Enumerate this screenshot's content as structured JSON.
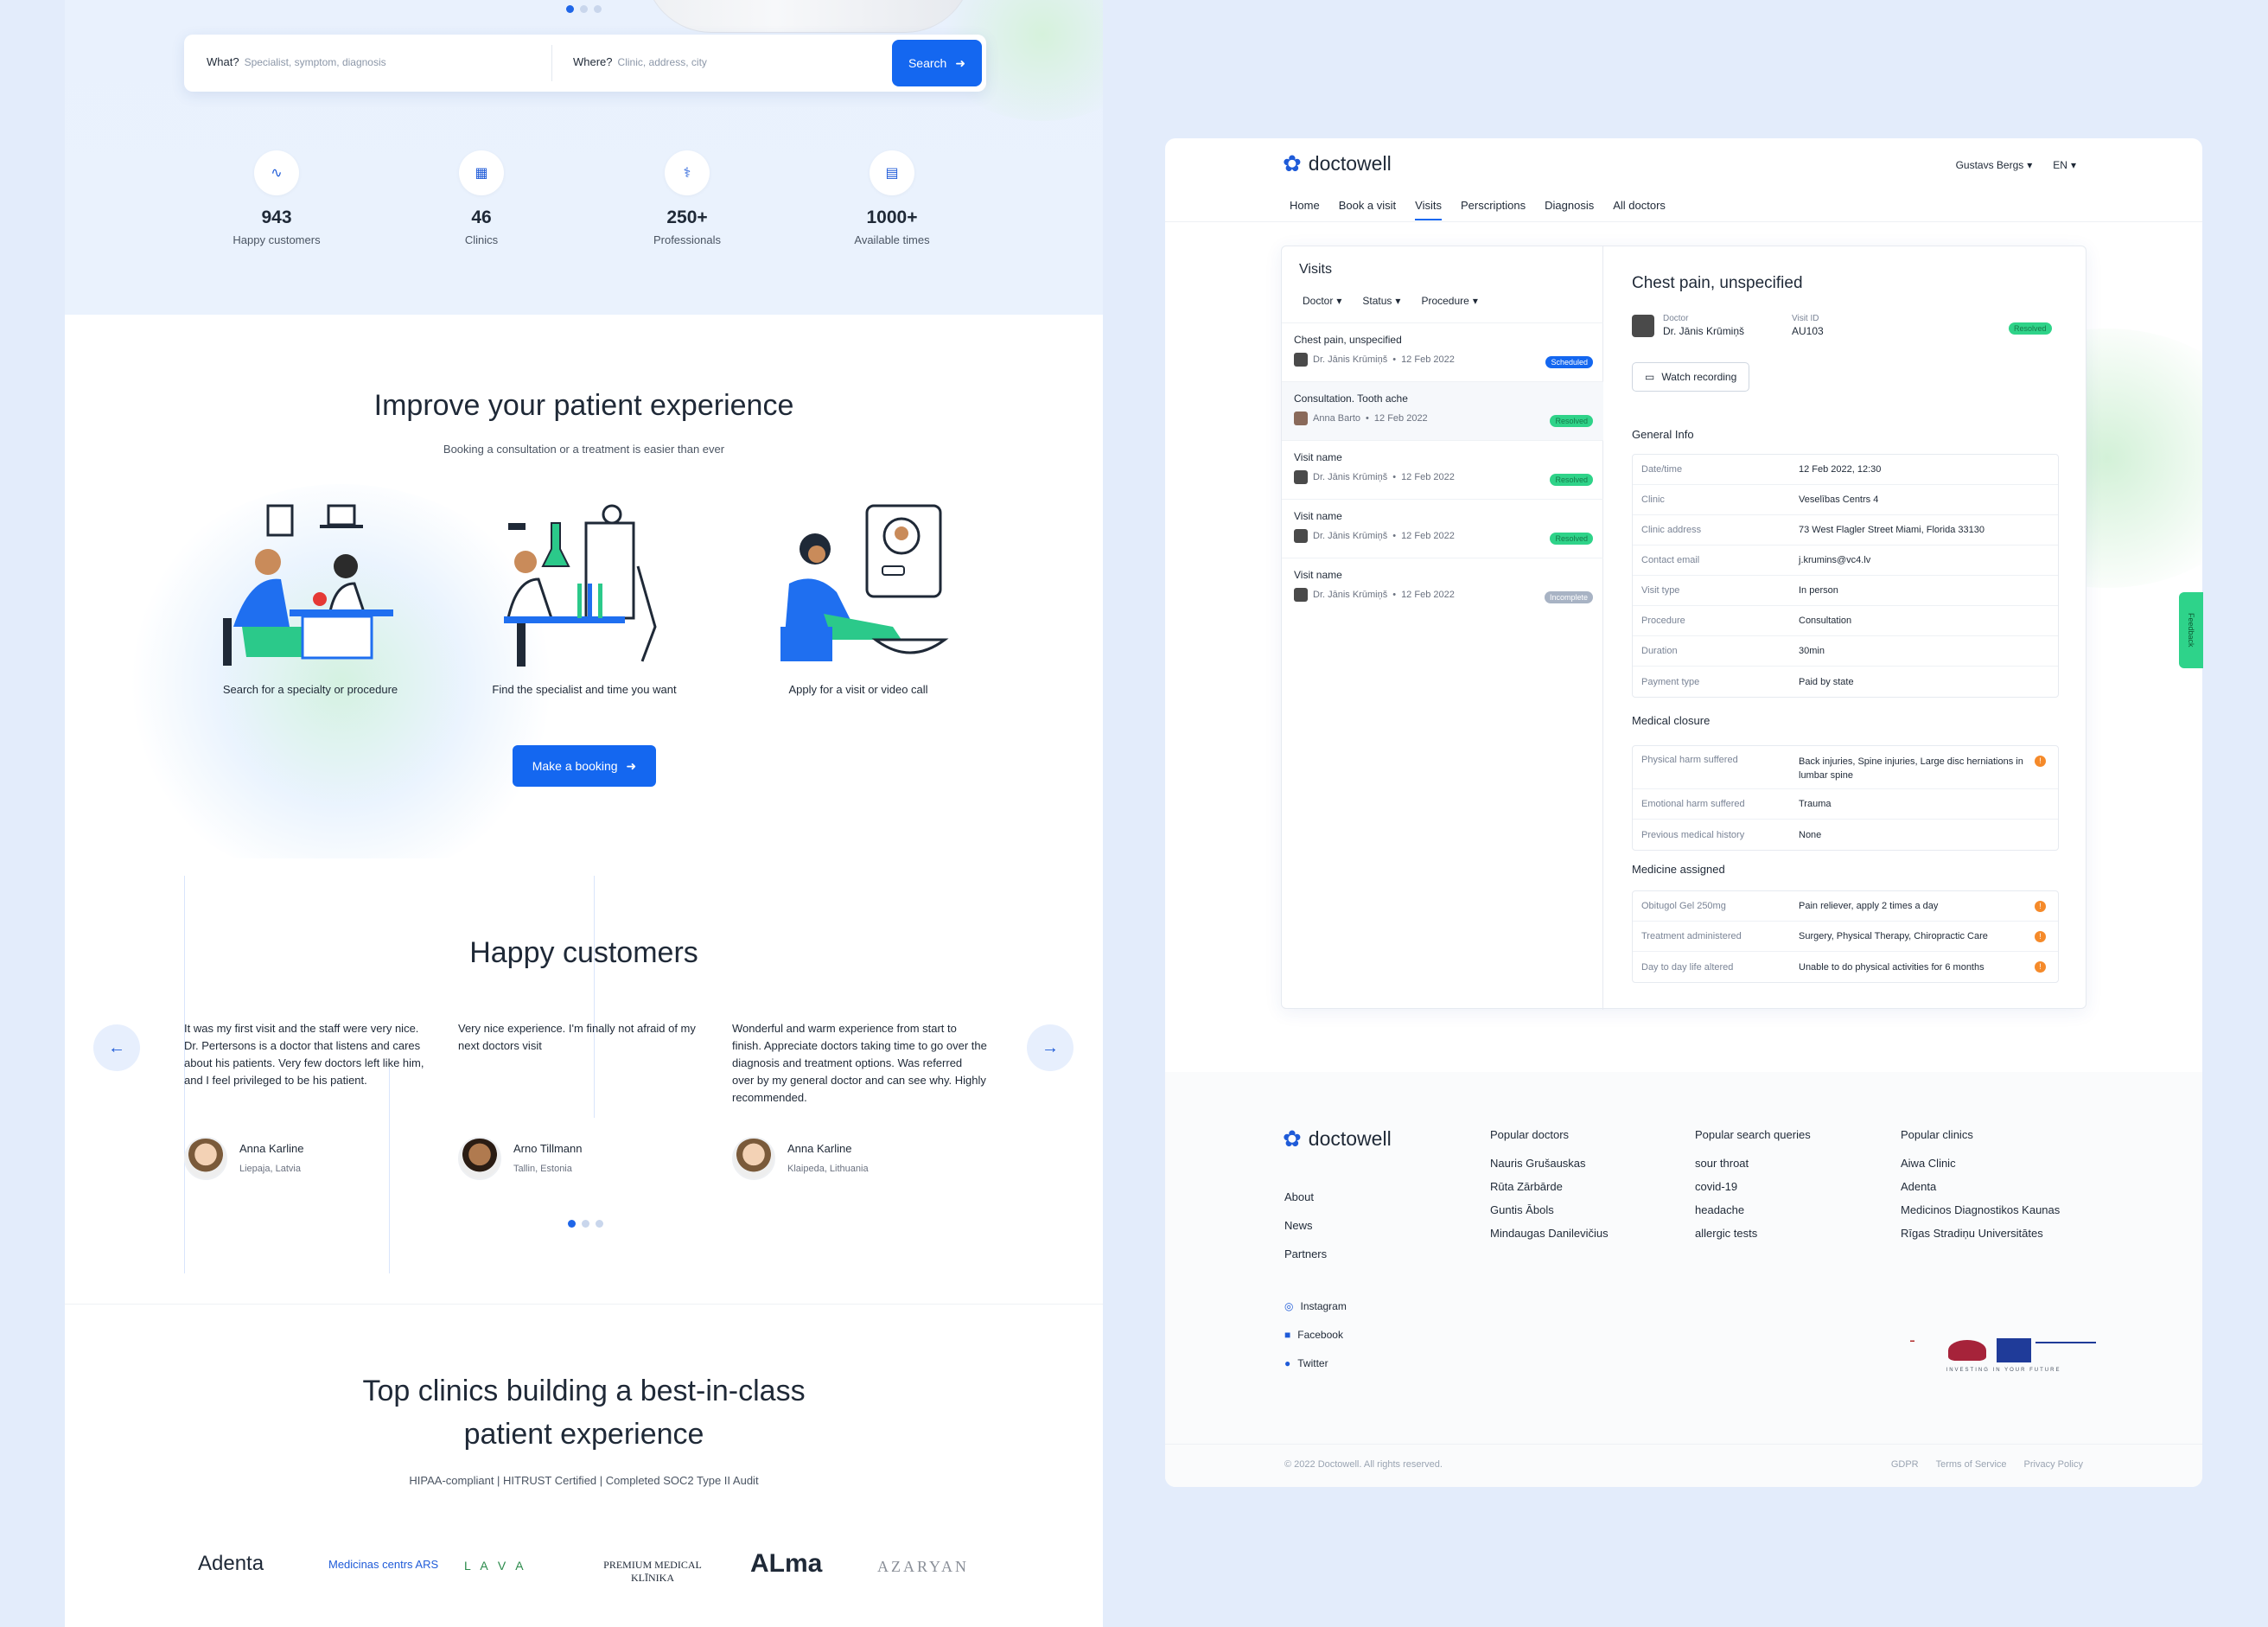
{
  "search": {
    "what_label": "What?",
    "what_placeholder": "Specialist, symptom, diagnosis",
    "where_label": "Where?",
    "where_placeholder": "Clinic, address, city",
    "button": "Search"
  },
  "stats": [
    {
      "value": "943",
      "label": "Happy customers",
      "icon": "pulse-icon"
    },
    {
      "value": "46",
      "label": "Clinics",
      "icon": "hospital-icon"
    },
    {
      "value": "250+",
      "label": "Professionals",
      "icon": "stethoscope-icon"
    },
    {
      "value": "1000+",
      "label": "Available times",
      "icon": "calendar-icon"
    }
  ],
  "improve": {
    "title": "Improve your patient experience",
    "subtitle": "Booking a consultation or a treatment is easier than ever",
    "steps": [
      "Search for a specialty or procedure",
      "Find the specialist and time you want",
      "Apply for a visit or video call"
    ],
    "button": "Make a booking"
  },
  "reviews": {
    "title": "Happy customers",
    "items": [
      {
        "text": "It was my first visit and the staff were very nice. Dr. Pertersons is a doctor that listens and cares about his patients. Very few doctors left like him, and I feel privileged to be his patient.",
        "name": "Anna Karline",
        "location": "Liepaja, Latvia"
      },
      {
        "text": "Very nice experience. I'm finally not afraid of my next doctors visit",
        "name": "Arno Tillmann",
        "location": "Tallin, Estonia"
      },
      {
        "text": "Wonderful and warm experience from start to finish. Appreciate doctors taking time to go over the diagnosis and treatment options. Was referred over by my general doctor and can see why. Highly recommended.",
        "name": "Anna Karline",
        "location": "Klaipeda, Lithuania"
      }
    ]
  },
  "clinics": {
    "title_line1": "Top clinics building a best-in-class",
    "title_line2": "patient experience",
    "subtitle": "HIPAA-compliant | HITRUST Certified | Completed SOC2 Type II Audit",
    "logos": [
      "Adenta",
      "Medicinas centrs ARS",
      "L A V A",
      "PREMIUM MEDICAL KLĪNIKA",
      "ALma",
      "AZARYAN"
    ]
  },
  "app": {
    "brand": "doctowell",
    "user": "Gustavs Bergs",
    "lang": "EN",
    "nav": [
      "Home",
      "Book a visit",
      "Visits",
      "Perscriptions",
      "Diagnosis",
      "All doctors"
    ],
    "active_nav": "Visits",
    "visits_title": "Visits",
    "filters": [
      "Doctor",
      "Status",
      "Procedure"
    ],
    "visits": [
      {
        "name": "Chest pain, unspecified",
        "doctor": "Dr. Jānis Krūmiņš",
        "date": "12 Feb 2022",
        "status": "Scheduled"
      },
      {
        "name": "Consultation. Tooth ache",
        "doctor": "Anna Barto",
        "date": "12 Feb 2022",
        "status": "Resolved"
      },
      {
        "name": "Visit name",
        "doctor": "Dr. Jānis Krūmiņš",
        "date": "12 Feb 2022",
        "status": "Resolved"
      },
      {
        "name": "Visit name",
        "doctor": "Dr. Jānis Krūmiņš",
        "date": "12 Feb 2022",
        "status": "Resolved"
      },
      {
        "name": "Visit name",
        "doctor": "Dr. Jānis Krūmiņš",
        "date": "12 Feb 2022",
        "status": "Incomplete"
      }
    ],
    "detail": {
      "title": "Chest pain, unspecified",
      "doctor_label": "Doctor",
      "doctor": "Dr. Jānis Krūmiņš",
      "visit_id_label": "Visit ID",
      "visit_id": "AU103",
      "status": "Resolved",
      "watch": "Watch recording",
      "general_title": "General Info",
      "general": [
        {
          "k": "Date/time",
          "v": "12 Feb 2022, 12:30"
        },
        {
          "k": "Clinic",
          "v": "Veselības Centrs 4"
        },
        {
          "k": "Clinic address",
          "v": "73 West Flagler Street Miami, Florida 33130"
        },
        {
          "k": "Contact email",
          "v": "j.krumins@vc4.lv"
        },
        {
          "k": "Visit type",
          "v": "In person"
        },
        {
          "k": "Procedure",
          "v": "Consultation"
        },
        {
          "k": "Duration",
          "v": "30min"
        },
        {
          "k": "Payment type",
          "v": "Paid by state"
        }
      ],
      "closure_title": "Medical closure",
      "closure": [
        {
          "k": "Physical harm suffered",
          "v": "Back injuries, Spine injuries, Large disc herniations in lumbar spine"
        },
        {
          "k": "Emotional harm suffered",
          "v": "Trauma"
        },
        {
          "k": "Previous medical history",
          "v": "None"
        }
      ],
      "medicine_title": "Medicine assigned",
      "medicine": [
        {
          "k": "Obitugol Gel 250mg",
          "v": "Pain reliever, apply 2 times a day"
        },
        {
          "k": "Treatment administered",
          "v": "Surgery, Physical Therapy, Chiropractic Care"
        },
        {
          "k": "Day to day life altered",
          "v": "Unable to do physical activities for 6 months"
        }
      ]
    },
    "footer": {
      "links": [
        "About",
        "News",
        "Partners"
      ],
      "social": [
        "Instagram",
        "Facebook",
        "Twitter"
      ],
      "col1_title": "Popular doctors",
      "col1": [
        "Nauris Grušauskas",
        "Rūta Zārbārde",
        "Guntis Ābols",
        "Mindaugas Danilevičius"
      ],
      "col2_title": "Popular search queries",
      "col2": [
        "sour throat",
        "covid-19",
        "headache",
        "allergic tests"
      ],
      "col3_title": "Popular clinics",
      "col3": [
        "Aiwa Clinic",
        "Adenta",
        "Medicinos Diagnostikos Kaunas",
        "Rīgas Stradiņu Universitātes"
      ],
      "copyright": "© 2022 Doctowell. All rights reserved.",
      "legal": [
        "GDPR",
        "Terms of Service",
        "Privacy Policy"
      ],
      "eu_text": "INVESTING IN YOUR FUTURE"
    },
    "feedback": "Feedback"
  },
  "colors": {
    "accent": "#1467f0",
    "resolved": "#2fd389",
    "incomplete": "#a8b3c4",
    "warning": "#f58a2a"
  }
}
